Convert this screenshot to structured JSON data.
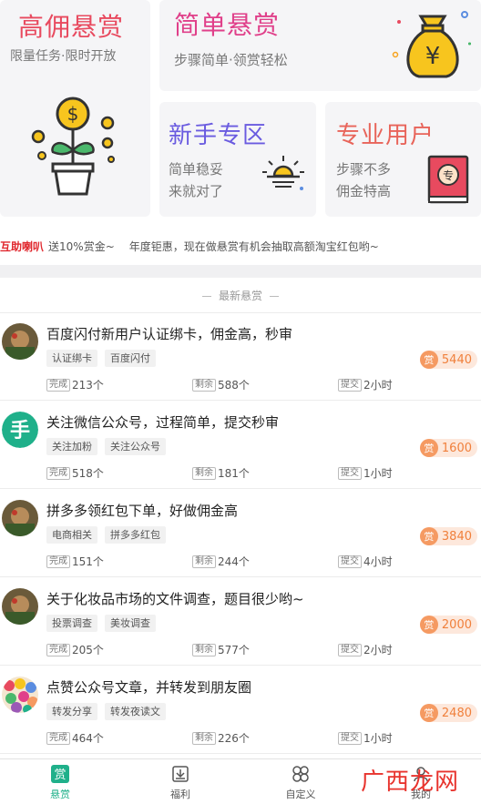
{
  "promo": {
    "big": {
      "title": "高佣悬赏",
      "subtitle": "限量任务·限时开放"
    },
    "wide": {
      "title": "简单悬赏",
      "subtitle": "步骤简单·领赏轻松"
    },
    "newbie": {
      "title": "新手专区",
      "line1": "简单稳妥",
      "line2": "来就对了"
    },
    "pro": {
      "title": "专业用户",
      "line1": "步骤不多",
      "line2": "佣金特高"
    }
  },
  "ticker": {
    "label": "互助喇叭",
    "item1": "送10%赏金~",
    "item2": "年度钜惠，现在做悬赏有机会抽取高额淘宝红包哟~"
  },
  "section": {
    "title": "最新悬赏"
  },
  "stat_labels": {
    "done": "完成",
    "left": "剩余",
    "submit": "提交"
  },
  "reward_icon_text": "赏",
  "tasks": [
    {
      "title": "百度闪付新用户认证绑卡，佣金高，秒审",
      "tags": [
        "认证绑卡",
        "百度闪付"
      ],
      "reward": "5440",
      "done": "213个",
      "left": "588个",
      "submit": "2小时"
    },
    {
      "title": "关注微信公众号，过程简单，提交秒审",
      "tags": [
        "关注加粉",
        "关注公众号"
      ],
      "reward": "1600",
      "done": "518个",
      "left": "181个",
      "submit": "1小时"
    },
    {
      "title": "拼多多领红包下单，好做佣金高",
      "tags": [
        "电商相关",
        "拼多多红包"
      ],
      "reward": "3840",
      "done": "151个",
      "left": "244个",
      "submit": "4小时"
    },
    {
      "title": "关于化妆品市场的文件调查，题目很少哟~",
      "tags": [
        "投票调查",
        "美妆调查"
      ],
      "reward": "2000",
      "done": "205个",
      "left": "577个",
      "submit": "2小时"
    },
    {
      "title": "点赞公众号文章，并转发到朋友圈",
      "tags": [
        "转发分享",
        "转发夜读文"
      ],
      "reward": "2480",
      "done": "464个",
      "left": "226个",
      "submit": "1小时"
    }
  ],
  "tabs": [
    {
      "label": "悬赏",
      "icon_text": "赏"
    },
    {
      "label": "福利"
    },
    {
      "label": "自定义"
    },
    {
      "label": "我的"
    }
  ],
  "watermark": "广西龙网",
  "colors": {
    "accent": "#1fb08a",
    "reward": "#f0803c",
    "ticker": "#e0282e"
  }
}
